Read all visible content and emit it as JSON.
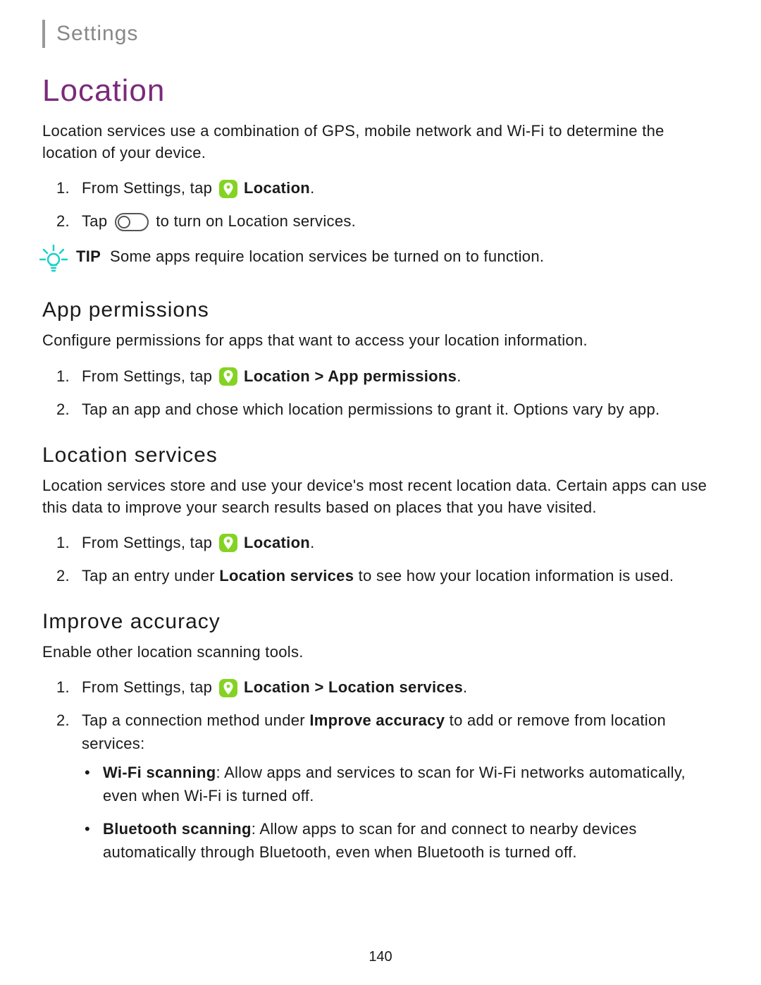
{
  "header": "Settings",
  "page_number": "140",
  "h1": "Location",
  "intro": "Location services use a combination of GPS, mobile network and Wi-Fi to determine the location of your device.",
  "steps1": {
    "a_pre": "From Settings, tap ",
    "a_bold": "Location",
    "a_post": ".",
    "b_pre": "Tap ",
    "b_post": " to turn on Location services."
  },
  "tip_label": "TIP",
  "tip_text": "Some apps require location services be turned on to function.",
  "h2_app": "App permissions",
  "app_body": "Configure permissions for apps that want to access your location information.",
  "steps_app": {
    "a_pre": "From Settings, tap ",
    "a_bold": "Location > App permissions",
    "a_post": ".",
    "b": "Tap an app and chose which location permissions to grant it. Options vary by app."
  },
  "h2_loc": "Location services",
  "loc_body": "Location services store and use your device's most recent location data. Certain apps can use this data to improve your search results based on places that you have visited.",
  "steps_loc": {
    "a_pre": "From Settings, tap ",
    "a_bold": "Location",
    "a_post": ".",
    "b_pre": "Tap an entry under ",
    "b_bold": "Location services",
    "b_post": " to see how your location information is used."
  },
  "h2_imp": "Improve accuracy",
  "imp_body": "Enable other location scanning tools.",
  "steps_imp": {
    "a_pre": "From Settings, tap ",
    "a_bold": "Location > Location services",
    "a_post": ".",
    "b_pre": "Tap a connection method under ",
    "b_bold": "Improve accuracy",
    "b_post": " to add or remove from location services:"
  },
  "bullets": {
    "wifi_label": "Wi-Fi scanning",
    "wifi_text": ": Allow apps and services to scan for Wi-Fi networks automatically, even when Wi-Fi is turned off.",
    "bt_label": "Bluetooth scanning",
    "bt_text": ": Allow apps to scan for and connect to nearby devices automatically through Bluetooth, even when Bluetooth is turned off."
  }
}
